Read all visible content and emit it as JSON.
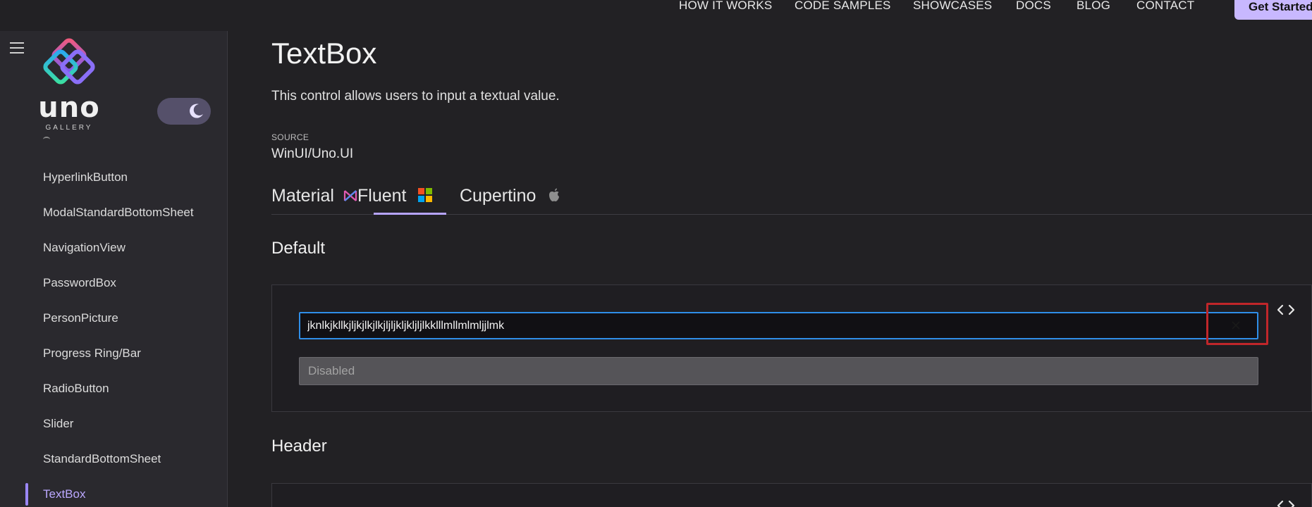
{
  "top_nav": {
    "links": [
      "HOW IT WORKS",
      "CODE SAMPLES",
      "SHOWCASES",
      "DOCS",
      "BLOG",
      "CONTACT"
    ],
    "cta": "Get Started"
  },
  "sidebar": {
    "logo_text": "uno",
    "logo_subtext": "GALLERY",
    "items": [
      {
        "label": "HyperlinkButton"
      },
      {
        "label": "ModalStandardBottomSheet"
      },
      {
        "label": "NavigationView"
      },
      {
        "label": "PasswordBox"
      },
      {
        "label": "PersonPicture"
      },
      {
        "label": "Progress Ring/Bar"
      },
      {
        "label": "RadioButton"
      },
      {
        "label": "Slider"
      },
      {
        "label": "StandardBottomSheet"
      },
      {
        "label": "TextBox"
      }
    ],
    "active_item": "TextBox"
  },
  "page": {
    "title": "TextBox",
    "description": "This control allows users to input a textual value.",
    "source_label": "SOURCE",
    "source_value": "WinUI/Uno.UI"
  },
  "tabs": [
    {
      "label": "Material",
      "icon": "material-icon"
    },
    {
      "label": "Fluent",
      "icon": "windows-icon"
    },
    {
      "label": "Cupertino",
      "icon": "apple-icon"
    }
  ],
  "active_tab": "Fluent",
  "sections": {
    "default": {
      "heading": "Default",
      "textbox_value": "jknlkjkllkjljkjlkjlkjljljkljkljljlkklllmllmlmljjlmk",
      "disabled_placeholder": "Disabled"
    },
    "header": {
      "heading": "Header"
    }
  },
  "colors": {
    "accent": "#b6a4ff",
    "focus_border": "#2f8ee8",
    "highlight": "#c0262a",
    "background": "#222124"
  }
}
